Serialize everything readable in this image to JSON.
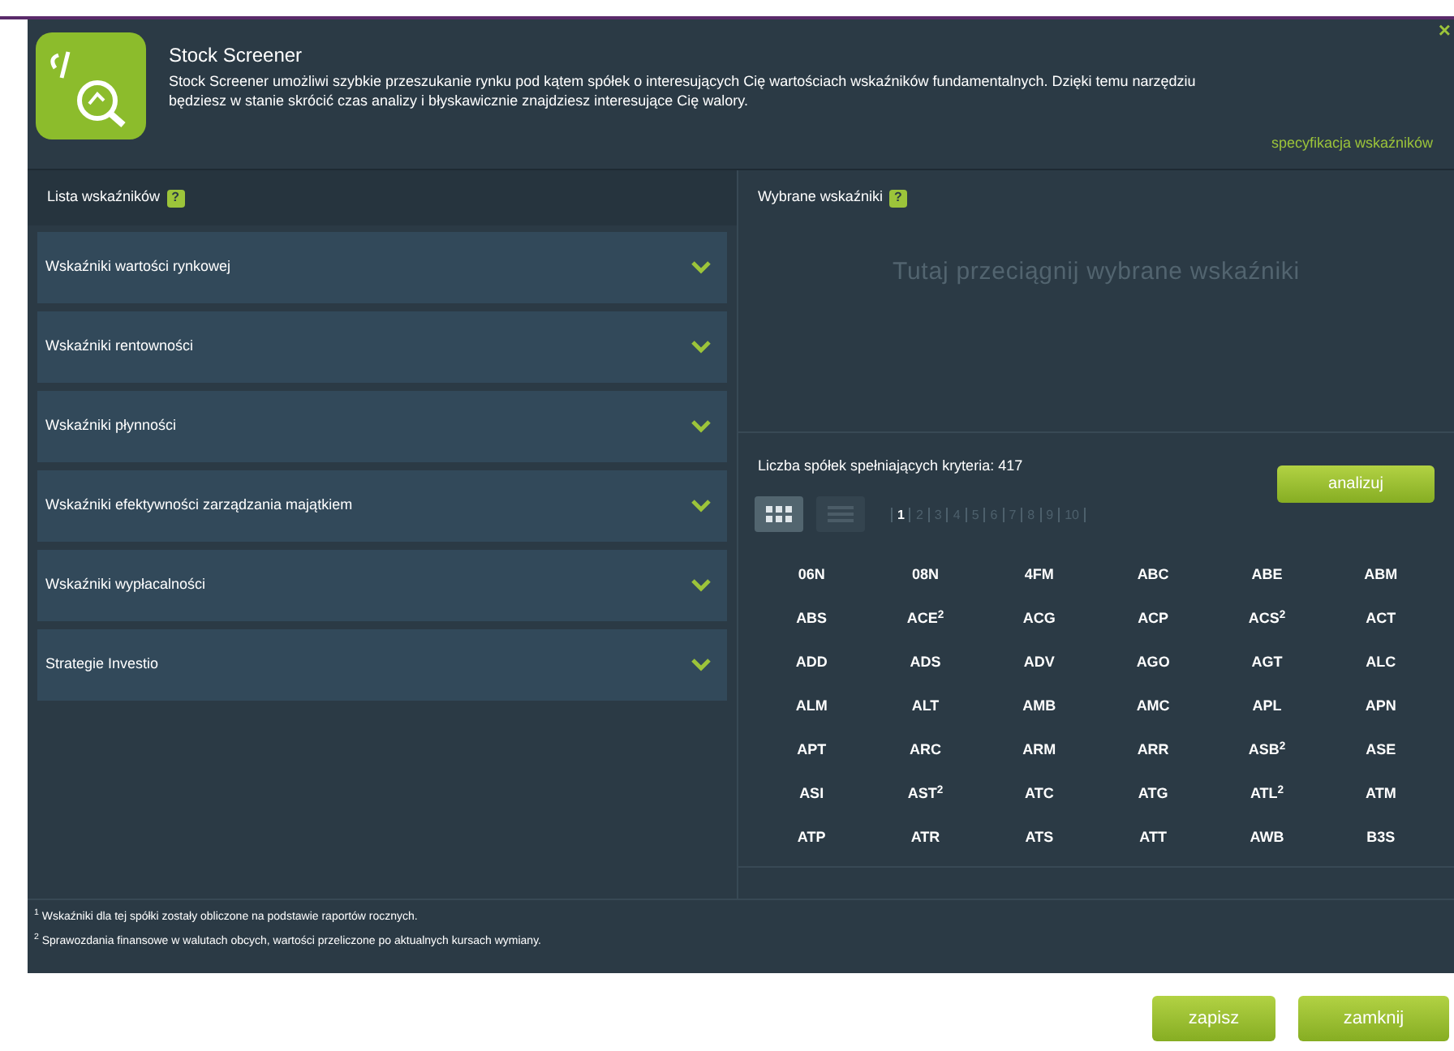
{
  "dialog": {
    "title": "Stock Screener",
    "description": "Stock Screener umożliwi szybkie przeszukanie rynku pod kątem spółek o interesujących Cię wartościach wskaźników fundamentalnych. Dzięki temu narzędziu będziesz w stanie skrócić czas analizy i błyskawicznie znajdziesz interesujące Cię walory.",
    "link": "specyfikacja wskaźników",
    "close": "×"
  },
  "indicators_panel": {
    "title": "Lista wskaźników",
    "help": "?",
    "items": [
      {
        "label": "Wskaźniki wartości rynkowej",
        "expanded": false
      },
      {
        "label": "Wskaźniki rentowności",
        "expanded": false
      },
      {
        "label": "Wskaźniki płynności",
        "expanded": false
      },
      {
        "label": "Wskaźniki efektywności zarządzania majątkiem",
        "expanded": false
      },
      {
        "label": "Wskaźniki wypłacalności",
        "expanded": false
      },
      {
        "label": "Strategie Investio",
        "expanded": false
      }
    ]
  },
  "selected_panel": {
    "title": "Wybrane wskaźniki",
    "help": "?",
    "drop_hint": "Tutaj przeciągnij wybrane wskaźniki",
    "count_label": "Liczba spółek spełniających kryteria: 417",
    "analyze_button": "analizuj",
    "views": [
      {
        "kind": "grid",
        "selected": true
      },
      {
        "kind": "list",
        "selected": false
      }
    ],
    "pages": [
      {
        "label": "1",
        "selected": true
      },
      {
        "label": "2",
        "selected": false
      },
      {
        "label": "3",
        "selected": false
      },
      {
        "label": "4",
        "selected": false
      },
      {
        "label": "5",
        "selected": false
      },
      {
        "label": "6",
        "selected": false
      },
      {
        "label": "7",
        "selected": false
      },
      {
        "label": "8",
        "selected": false
      },
      {
        "label": "9",
        "selected": false
      },
      {
        "label": "10",
        "selected": false
      }
    ],
    "tickers": [
      "06N",
      "08N",
      "4FM",
      "ABC",
      "ABE",
      "ABM",
      "ABS",
      "ACE$^{2}$",
      "ACG",
      "ACP",
      "ACS$^{2}$",
      "ACT",
      "ADD",
      "ADS",
      "ADV",
      "AGO",
      "AGT",
      "ALC",
      "ALM",
      "ALT",
      "AMB",
      "AMC",
      "APL",
      "APN",
      "APT",
      "ARC",
      "ARM",
      "ARR",
      "ASB$^{2}$",
      "ASE",
      "ASI",
      "AST$^{2}$",
      "ATC",
      "ATG",
      "ATL$^{2}$",
      "ATM",
      "ATP",
      "ATR",
      "ATS",
      "ATT",
      "AWB",
      "B3S"
    ]
  },
  "footnotes": [
    "$^{1}$ Wskaźniki dla tej spółki zostały obliczone na podstawie raportów rocznych.",
    "$^{2}$ Sprawozdania finansowe w walutach obcych, wartości przeliczone po aktualnych kursach wymiany."
  ],
  "buttons": [
    {
      "label": "zapisz"
    },
    {
      "label": "zamknij"
    }
  ]
}
